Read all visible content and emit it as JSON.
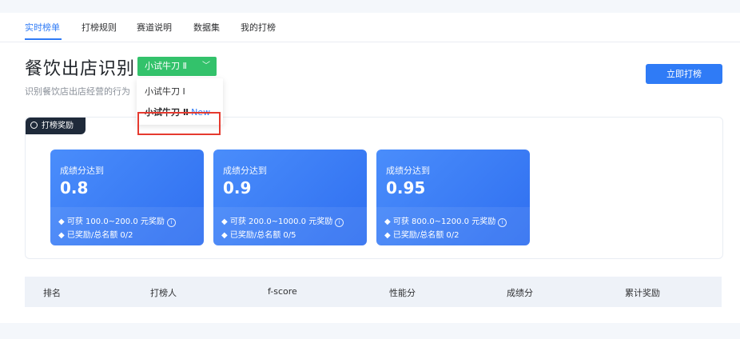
{
  "tabs": [
    {
      "label": "实时榜单",
      "active": true
    },
    {
      "label": "打榜规则",
      "active": false
    },
    {
      "label": "赛道说明",
      "active": false
    },
    {
      "label": "数据集",
      "active": false
    },
    {
      "label": "我的打榜",
      "active": false
    }
  ],
  "header": {
    "title": "餐饮出店识别",
    "subtitle": "识别餐饮店出店经营的行为",
    "level_selected": "小试牛刀 Ⅱ",
    "cta_label": "立即打榜"
  },
  "dropdown": {
    "options": [
      {
        "label": "小试牛刀 Ⅰ",
        "tag": ""
      },
      {
        "label": "小试牛刀 Ⅱ",
        "tag": "New"
      }
    ]
  },
  "rewards": {
    "badge": "打榜奖励",
    "cards": [
      {
        "label": "成绩分达到",
        "value": "0.8",
        "reward": "◆ 可获 100.0~200.0 元奖励",
        "quota": "◆ 已奖励/总名额 0/2"
      },
      {
        "label": "成绩分达到",
        "value": "0.9",
        "reward": "◆ 可获 200.0~1000.0 元奖励",
        "quota": "◆ 已奖励/总名额 0/5"
      },
      {
        "label": "成绩分达到",
        "value": "0.95",
        "reward": "◆ 可获 800.0~1200.0 元奖励",
        "quota": "◆ 已奖励/总名额 0/2"
      }
    ]
  },
  "table": {
    "columns": [
      "排名",
      "打榜人",
      "f-score",
      "性能分",
      "成绩分",
      "累计奖励"
    ]
  },
  "colors": {
    "accent": "#2f7bf6",
    "level_green": "#33c26b",
    "highlight_red": "#e53a2f"
  }
}
